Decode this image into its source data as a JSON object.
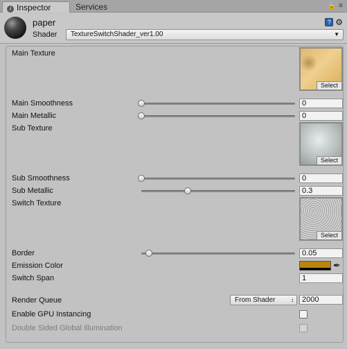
{
  "tabs": {
    "inspector": "Inspector",
    "services": "Services"
  },
  "header": {
    "material_name": "paper",
    "shader_label": "Shader",
    "shader_value": "TextureSwitchShader_ver1.00"
  },
  "properties": {
    "main_texture": {
      "label": "Main Texture",
      "select": "Select"
    },
    "main_smoothness": {
      "label": "Main Smoothness",
      "value": "0",
      "fraction": 0.0
    },
    "main_metallic": {
      "label": "Main Metallic",
      "value": "0",
      "fraction": 0.0
    },
    "sub_texture": {
      "label": "Sub Texture",
      "select": "Select"
    },
    "sub_smoothness": {
      "label": "Sub Smoothness",
      "value": "0",
      "fraction": 0.0
    },
    "sub_metallic": {
      "label": "Sub Metallic",
      "value": "0.3",
      "fraction": 0.3
    },
    "switch_texture": {
      "label": "Switch Texture",
      "select": "Select"
    },
    "border": {
      "label": "Border",
      "value": "0.05",
      "fraction": 0.05
    },
    "emission_color": {
      "label": "Emission Color",
      "color": "#b8860b"
    },
    "switch_span": {
      "label": "Switch Span",
      "value": "1"
    },
    "render_queue": {
      "label": "Render Queue",
      "dropdown": "From Shader",
      "value": "2000"
    },
    "gpu_instancing": {
      "label": "Enable GPU Instancing",
      "checked": false
    },
    "double_sided_gi": {
      "label": "Double Sided Global Illumination",
      "checked": false,
      "disabled": true
    }
  },
  "icons": [
    "info-icon",
    "lock-icon",
    "menu-icon",
    "material-sphere-icon",
    "help-book-icon",
    "gear-icon",
    "eyedropper-icon",
    "dropdown-arrow-icon"
  ]
}
